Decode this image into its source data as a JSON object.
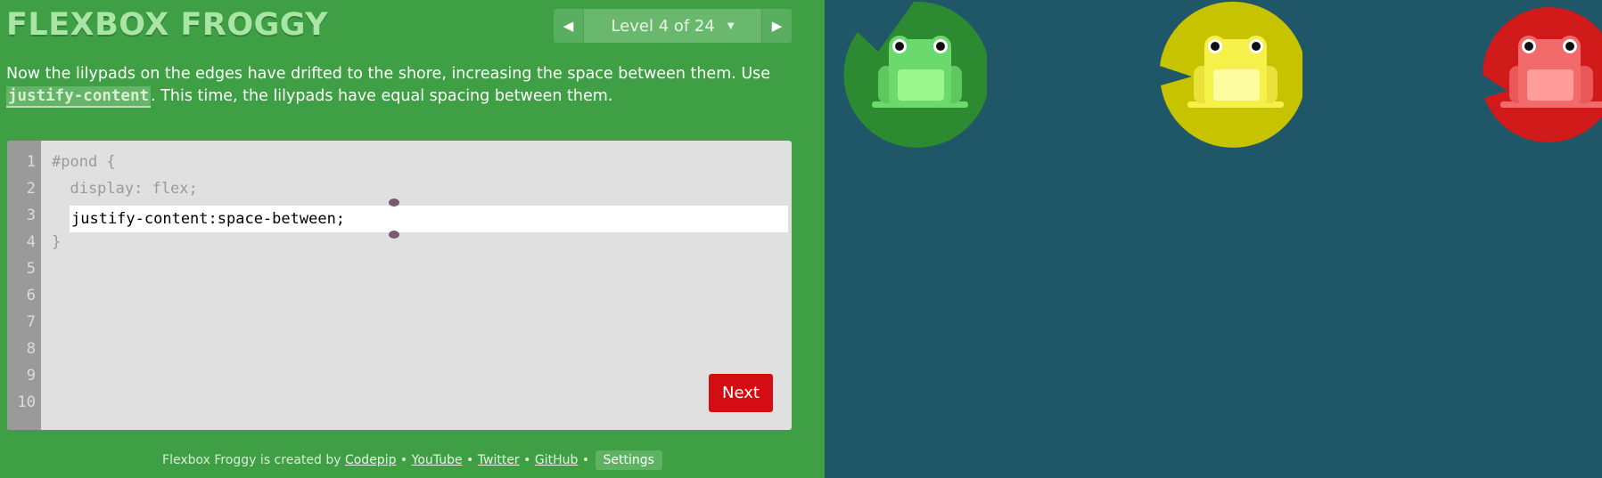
{
  "app": {
    "logo": "FLEXBOX FROGGY"
  },
  "level_nav": {
    "prev_icon": "◀",
    "label": "Level 4 of 24",
    "caret": "▼",
    "next_icon": "▶"
  },
  "instructions": {
    "text_before": "Now the lilypads on the edges have drifted to the shore, increasing the space between them. Use ",
    "code": "justify-content",
    "text_after": ". This time, the lilypads have equal spacing between them."
  },
  "editor": {
    "line_numbers": [
      "1",
      "2",
      "3",
      "4",
      "5",
      "6",
      "7",
      "8",
      "9",
      "10"
    ],
    "line1": "#pond {",
    "line2": "  display: flex;",
    "input_value": "justify-content:space-between;",
    "line4": "}",
    "next_label": "Next"
  },
  "footer": {
    "prefix": "Flexbox Froggy is created by ",
    "codepip": "Codepip",
    "sep": " • ",
    "youtube": "YouTube",
    "twitter": "Twitter",
    "github": "GitHub",
    "settings": "Settings"
  },
  "colors": {
    "sidebar": "#3f9f45",
    "pond": "#1f5768",
    "next_button": "#d40d12",
    "frog_green": "#6bd96c",
    "frog_yellow": "#f5f04a",
    "frog_red": "#f26a6a"
  },
  "frogs": [
    {
      "color": "green",
      "icon": "green-frog-icon"
    },
    {
      "color": "yellow",
      "icon": "yellow-frog-icon"
    },
    {
      "color": "red",
      "icon": "red-frog-icon"
    }
  ]
}
